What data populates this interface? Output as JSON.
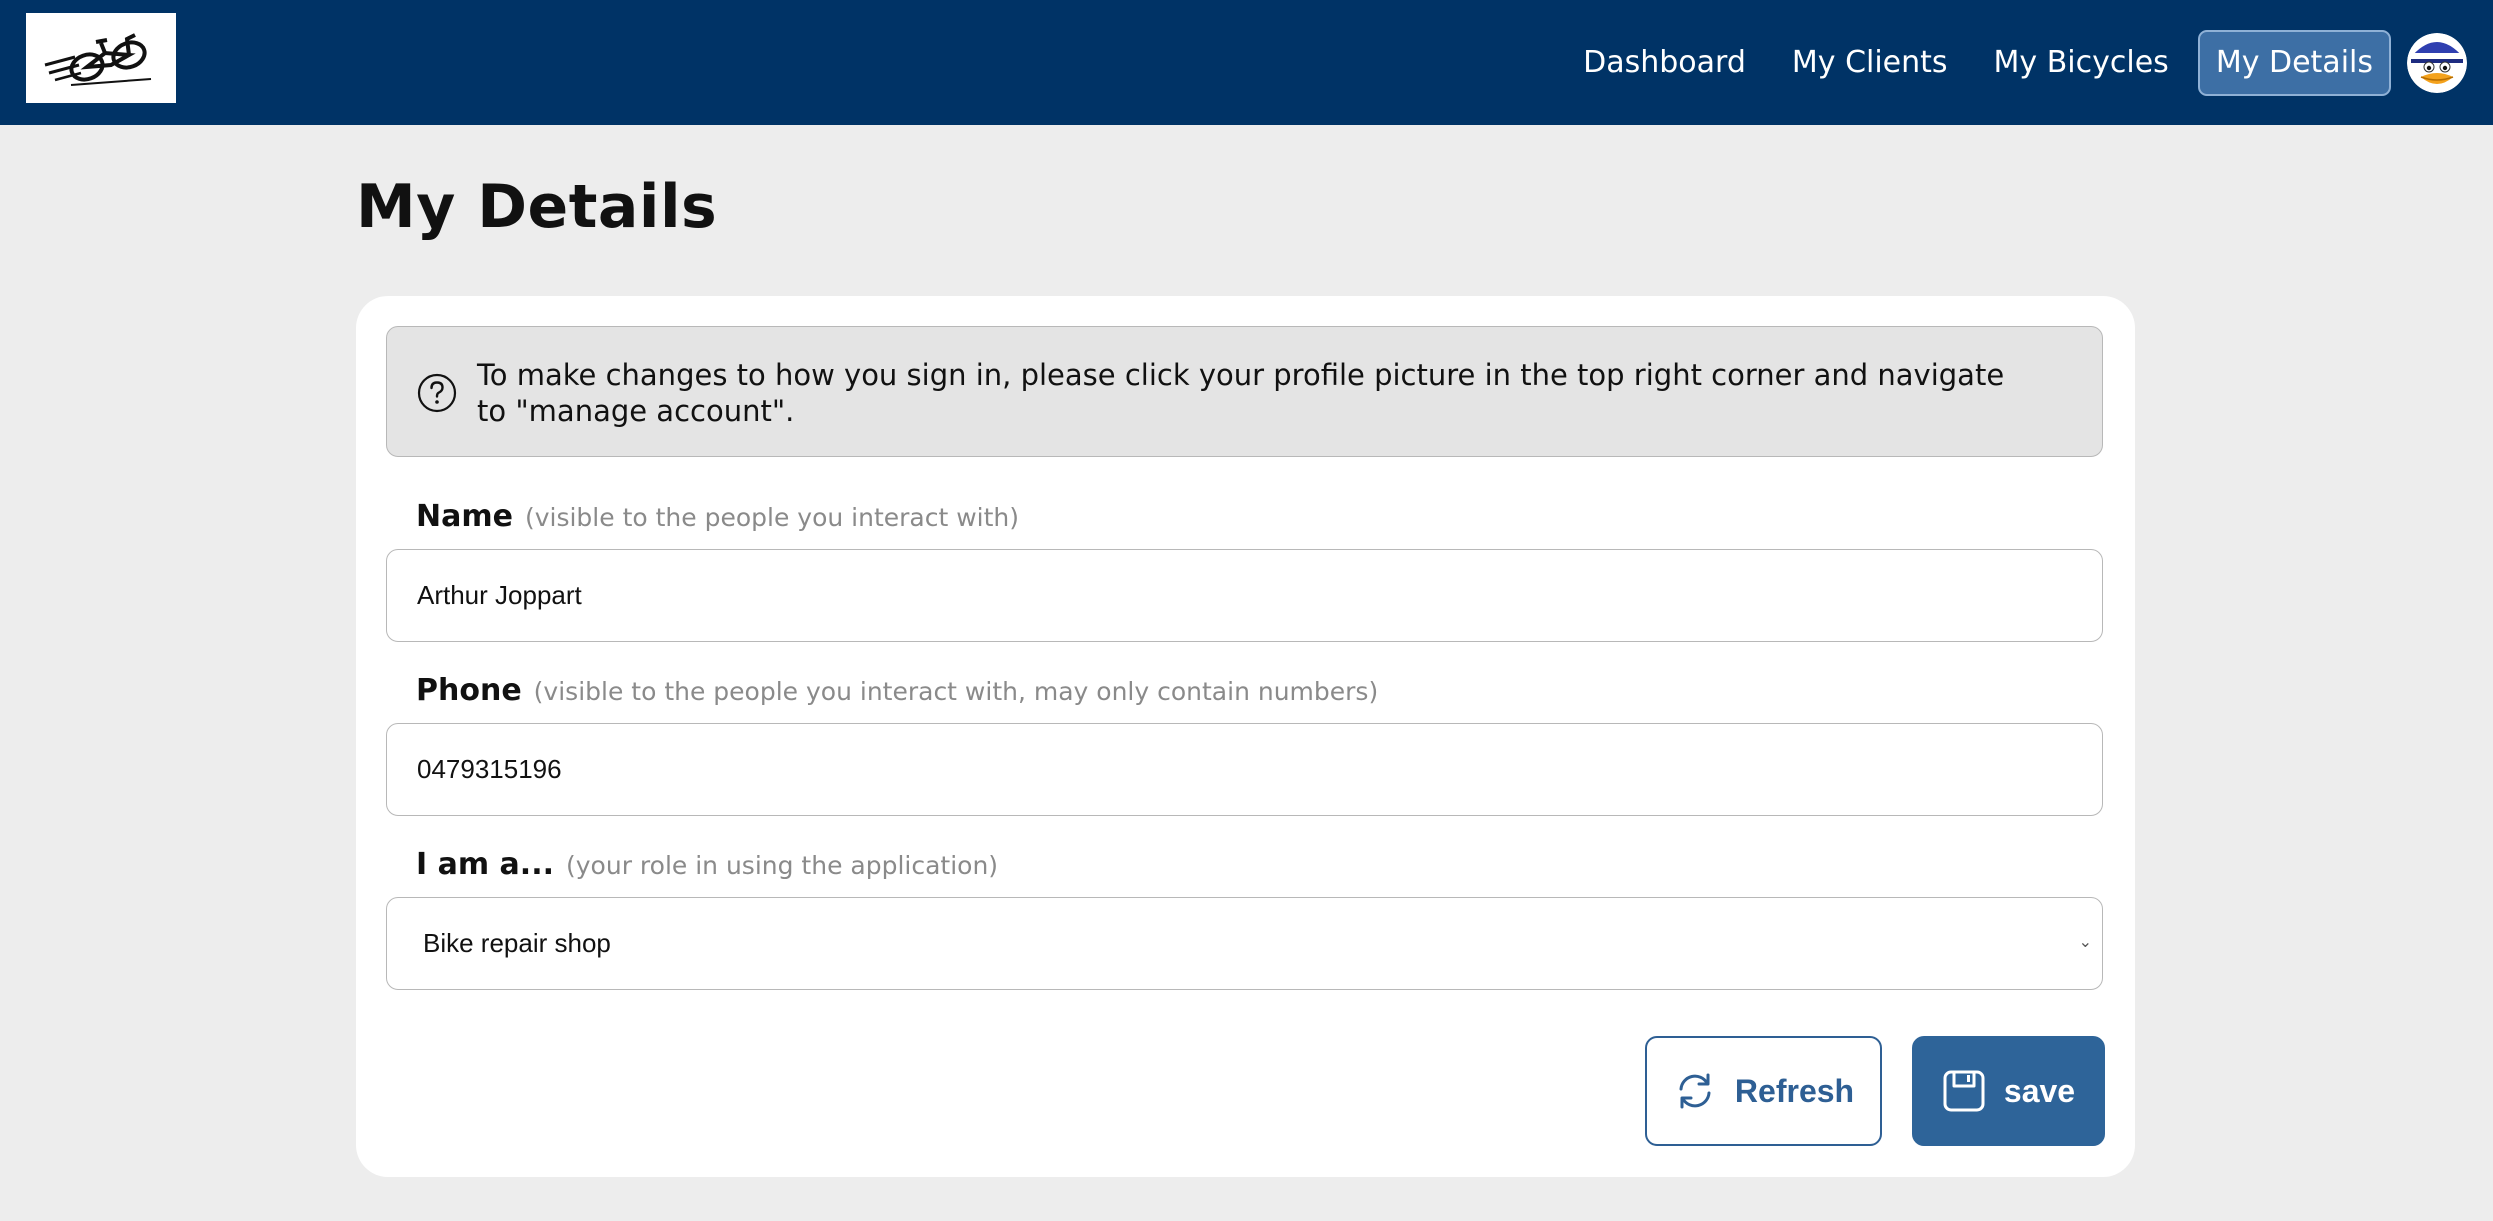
{
  "nav": {
    "items": [
      {
        "label": "Dashboard"
      },
      {
        "label": "My Clients"
      },
      {
        "label": "My Bicycles"
      },
      {
        "label": "My Details",
        "active": true
      }
    ]
  },
  "page": {
    "title": "My Details"
  },
  "info": {
    "text": "To make changes to how you sign in, please click your profile picture in the top right corner and navigate to \"manage account\"."
  },
  "form": {
    "name": {
      "label": "Name",
      "hint": "(visible to the people you interact with)",
      "value": "Arthur Joppart"
    },
    "phone": {
      "label": "Phone",
      "hint": "(visible to the people you interact with, may only contain numbers)",
      "value": "0479315196"
    },
    "role": {
      "label": "I am a...",
      "hint": "(your role in using the application)",
      "value": "Bike repair shop"
    }
  },
  "buttons": {
    "refresh": "Refresh",
    "save": "save"
  },
  "colors": {
    "navbar": "#003366",
    "accent": "#2e6499",
    "background": "#ededed"
  }
}
